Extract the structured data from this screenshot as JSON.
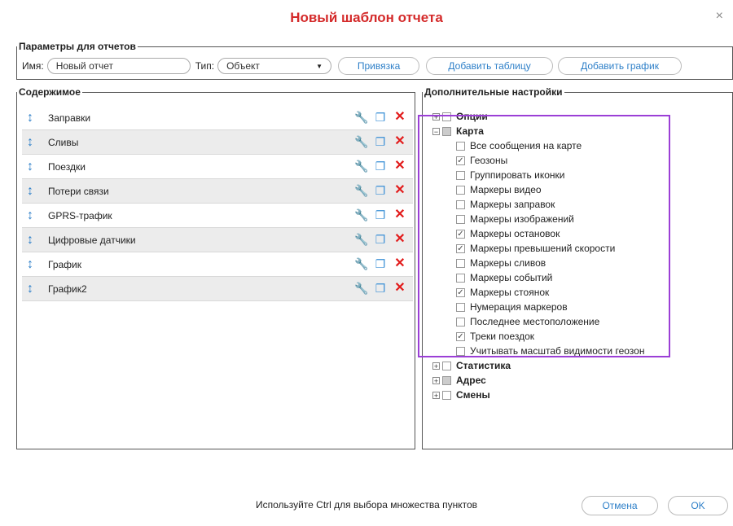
{
  "dialog": {
    "title": "Новый шаблон отчета",
    "close_label": "×"
  },
  "params": {
    "legend": "Параметры для отчетов",
    "name_label": "Имя:",
    "name_value": "Новый отчет",
    "type_label": "Тип:",
    "type_value": "Объект",
    "bind_label": "Привязка",
    "add_table_label": "Добавить таблицу",
    "add_chart_label": "Добавить график"
  },
  "content": {
    "legend": "Содержимое",
    "items": [
      {
        "label": "Заправки"
      },
      {
        "label": "Сливы"
      },
      {
        "label": "Поездки"
      },
      {
        "label": "Потери связи"
      },
      {
        "label": "GPRS-трафик"
      },
      {
        "label": "Цифровые датчики"
      },
      {
        "label": "График"
      },
      {
        "label": "График2"
      }
    ]
  },
  "extra": {
    "legend": "Дополнительные настройки",
    "options_label": "Опции",
    "map_label": "Карта",
    "map_items": [
      {
        "label": "Все сообщения на карте",
        "checked": false
      },
      {
        "label": "Геозоны",
        "checked": true
      },
      {
        "label": "Группировать иконки",
        "checked": false
      },
      {
        "label": "Маркеры видео",
        "checked": false
      },
      {
        "label": "Маркеры заправок",
        "checked": false
      },
      {
        "label": "Маркеры изображений",
        "checked": false
      },
      {
        "label": "Маркеры остановок",
        "checked": true
      },
      {
        "label": "Маркеры превышений скорости",
        "checked": true
      },
      {
        "label": "Маркеры сливов",
        "checked": false
      },
      {
        "label": "Маркеры событий",
        "checked": false
      },
      {
        "label": "Маркеры стоянок",
        "checked": true
      },
      {
        "label": "Нумерация маркеров",
        "checked": false
      },
      {
        "label": "Последнее местоположение",
        "checked": false
      },
      {
        "label": "Треки поездок",
        "checked": true
      },
      {
        "label": "Учитывать масштаб видимости геозон",
        "checked": false
      }
    ],
    "stats_label": "Статистика",
    "address_label": "Адрес",
    "shifts_label": "Смены"
  },
  "footer": {
    "hint": "Используйте Ctrl для выбора множества пунктов",
    "cancel_label": "Отмена",
    "ok_label": "OK"
  },
  "colors": {
    "title": "#d42a2a",
    "accent": "#2d7fc8",
    "delete": "#e21b1b",
    "highlight": "#9b3fd6"
  }
}
